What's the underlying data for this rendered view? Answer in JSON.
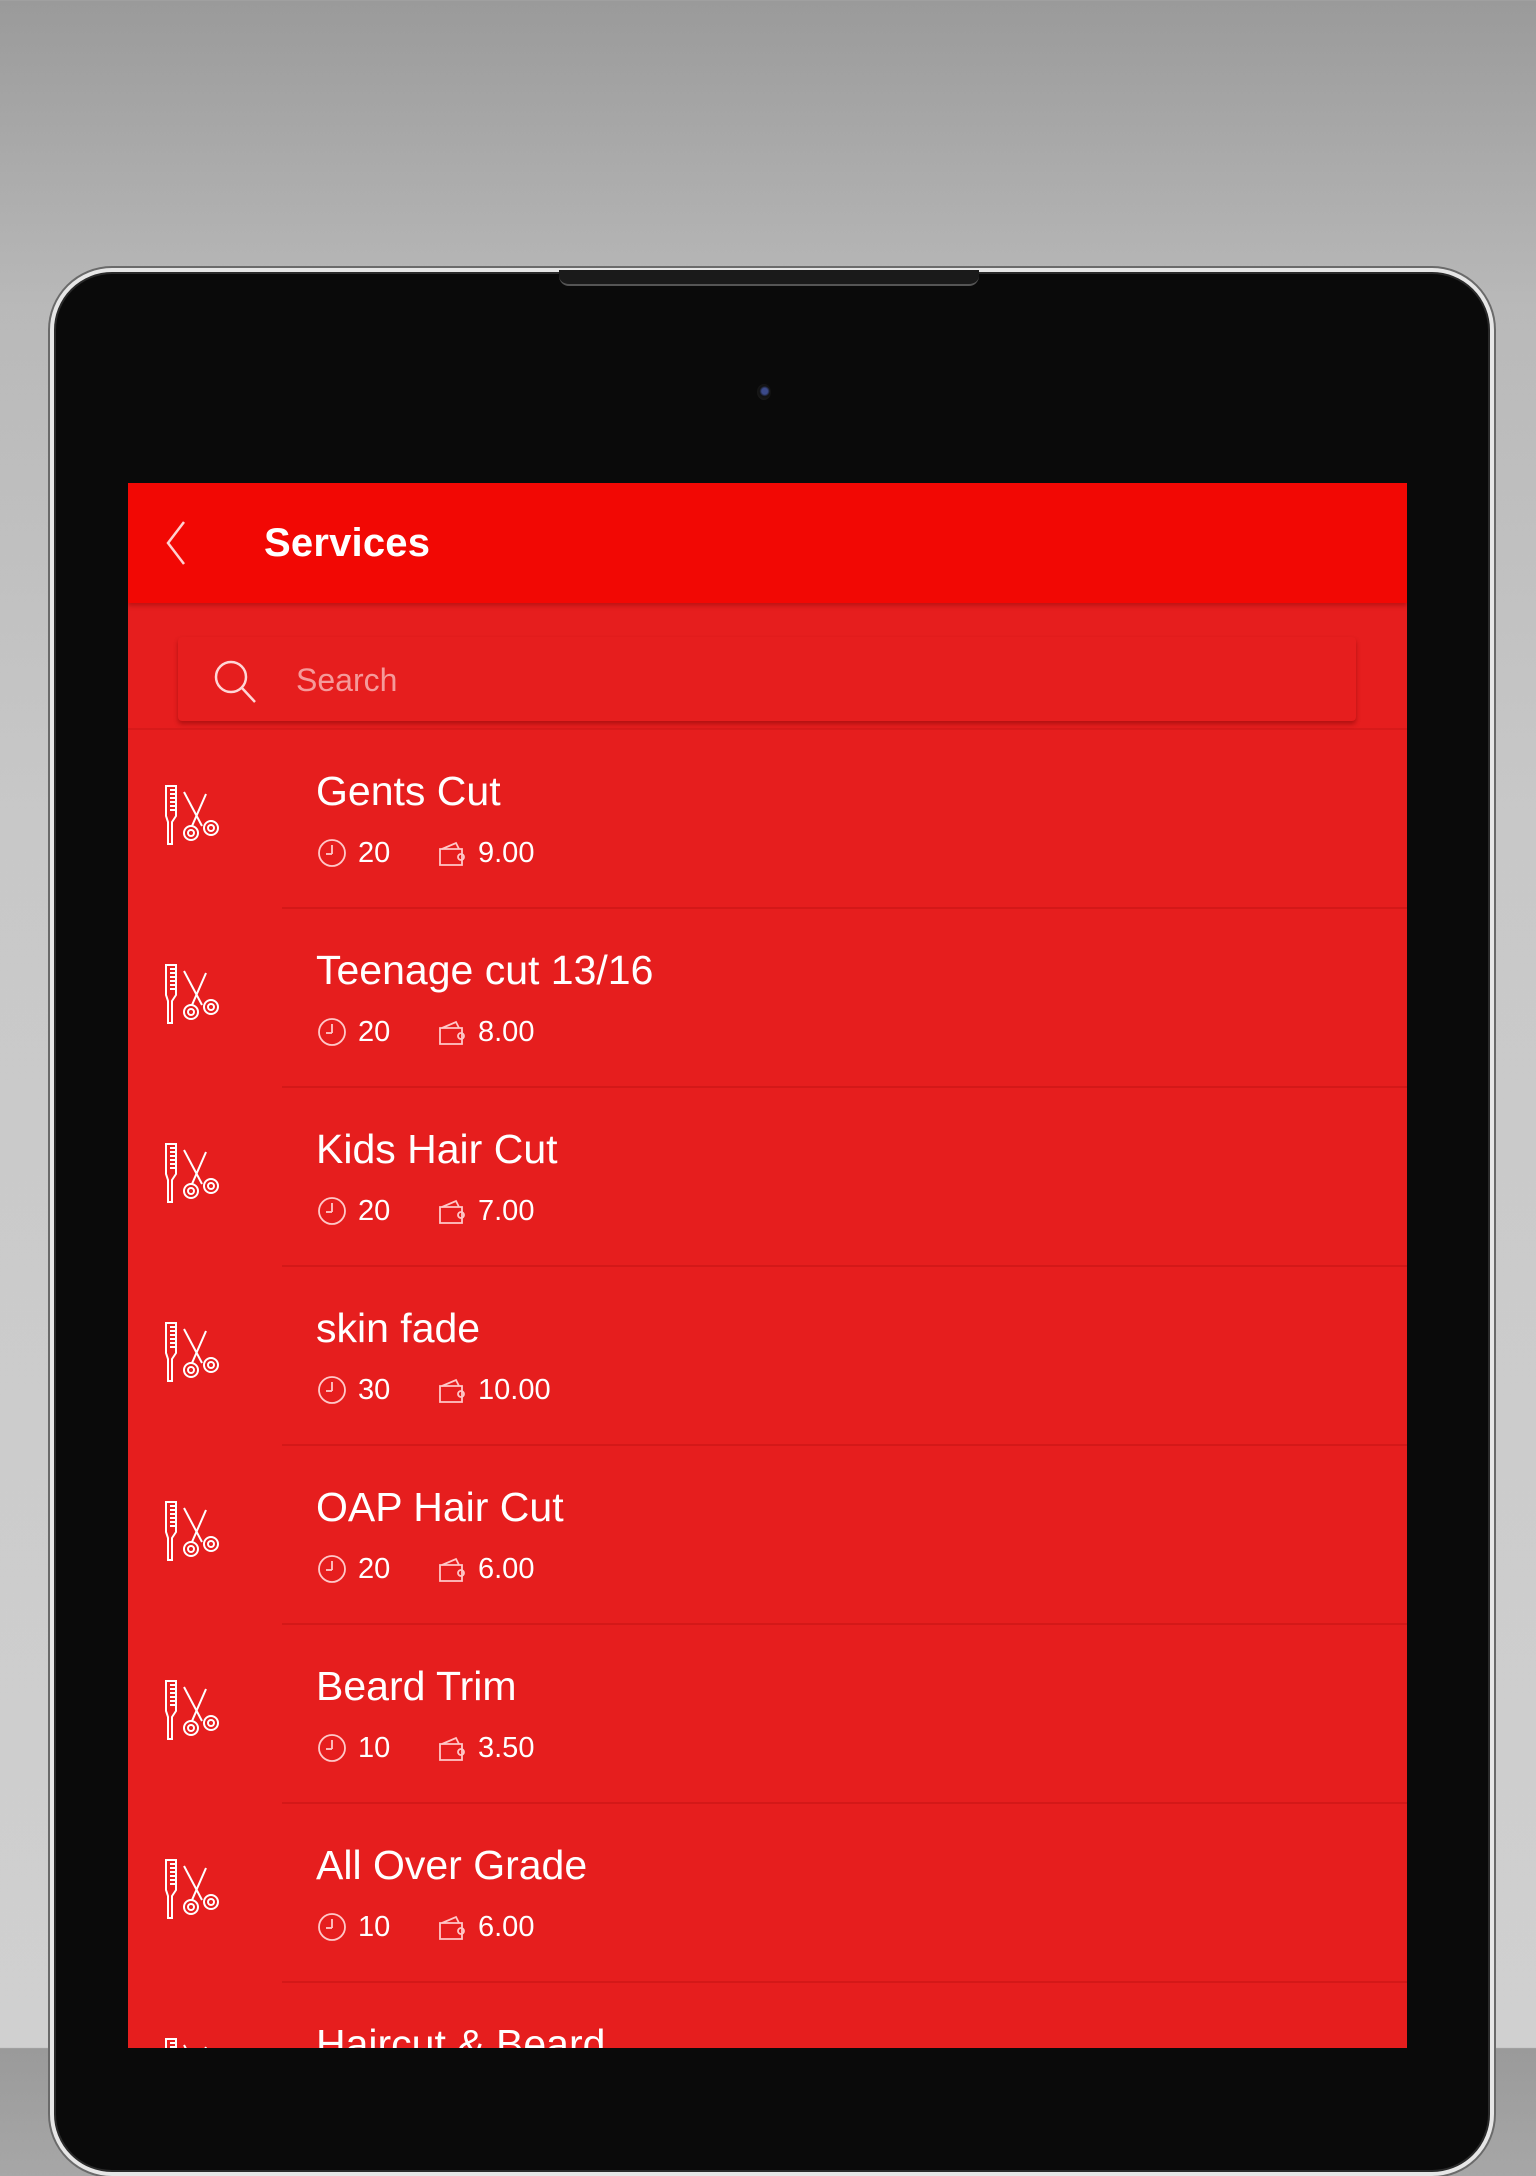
{
  "appbar": {
    "title": "Services",
    "back_icon": "chevron-left-icon"
  },
  "search": {
    "placeholder": "Search",
    "value": "",
    "icon": "search-icon"
  },
  "colors": {
    "appbar": "#f20804",
    "background": "#e61e1e",
    "text": "#ffffff",
    "placeholder": "#f59a9a"
  },
  "services": [
    {
      "name": "Gents Cut",
      "duration": "20",
      "price": "9.00"
    },
    {
      "name": "Teenage cut 13/16",
      "duration": "20",
      "price": "8.00"
    },
    {
      "name": "Kids Hair Cut",
      "duration": "20",
      "price": "7.00"
    },
    {
      "name": "skin fade",
      "duration": "30",
      "price": "10.00"
    },
    {
      "name": "OAP Hair Cut",
      "duration": "20",
      "price": "6.00"
    },
    {
      "name": "Beard Trim",
      "duration": "10",
      "price": "3.50"
    },
    {
      "name": "All Over Grade",
      "duration": "10",
      "price": "6.00"
    },
    {
      "name": "Haircut & Beard",
      "duration": "",
      "price": ""
    }
  ],
  "icons": {
    "service": "comb-scissors-icon",
    "duration": "clock-icon",
    "price": "wallet-icon"
  }
}
